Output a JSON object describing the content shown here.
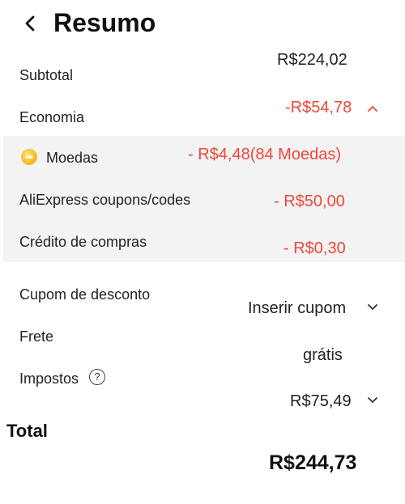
{
  "header": {
    "title": "Resumo"
  },
  "rows": {
    "subtotal": {
      "label": "Subtotal",
      "value": "R$224,02"
    },
    "economia": {
      "label": "Economia",
      "value": "-R$54,78"
    },
    "moedas": {
      "label": "Moedas",
      "value": "- R$4,48(84 Moedas)"
    },
    "coupons": {
      "label": "AliExpress coupons/codes",
      "value": "- R$50,00"
    },
    "credito": {
      "label": "Crédito de compras",
      "value": "- R$0,30"
    },
    "cupom": {
      "label": "Cupom de desconto",
      "value": "Inserir cupom"
    },
    "frete": {
      "label": "Frete",
      "value": "grátis"
    },
    "impostos": {
      "label": "Impostos",
      "help": "?",
      "value": "R$75,49"
    }
  },
  "total": {
    "label": "Total",
    "value": "R$244,73"
  },
  "icons": {
    "back": "back-arrow-icon",
    "coin": "coin-icon",
    "help": "question-circle-icon",
    "chevron_up": "chevron-up-icon",
    "chevron_down": "chevron-down-icon"
  },
  "colors": {
    "discount": "#f0473a",
    "panel": "#f3f3f3",
    "coin": "#f7b91e"
  }
}
